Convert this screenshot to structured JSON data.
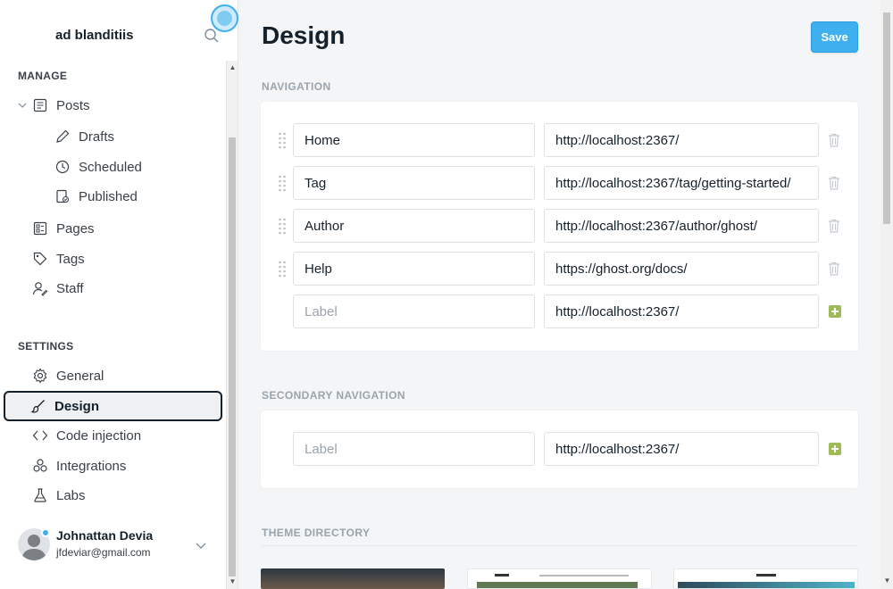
{
  "sidebar": {
    "blog_title": "ad blanditiis",
    "manage_label": "MANAGE",
    "settings_label": "SETTINGS",
    "manage_items": [
      {
        "label": "Posts",
        "icon": "posts-icon"
      },
      {
        "label": "Drafts",
        "icon": "pencil-icon"
      },
      {
        "label": "Scheduled",
        "icon": "clock-icon"
      },
      {
        "label": "Published",
        "icon": "published-icon"
      },
      {
        "label": "Pages",
        "icon": "pages-icon"
      },
      {
        "label": "Tags",
        "icon": "tag-icon"
      },
      {
        "label": "Staff",
        "icon": "staff-icon"
      }
    ],
    "settings_items": [
      {
        "label": "General",
        "icon": "gear-icon"
      },
      {
        "label": "Design",
        "icon": "brush-icon",
        "active": true
      },
      {
        "label": "Code injection",
        "icon": "code-icon"
      },
      {
        "label": "Integrations",
        "icon": "integrations-icon"
      },
      {
        "label": "Labs",
        "icon": "flask-icon"
      }
    ],
    "user": {
      "name": "Johnattan Devia",
      "email": "jfdeviar@gmail.com"
    }
  },
  "header": {
    "title": "Design",
    "save_label": "Save"
  },
  "navigation": {
    "heading": "NAVIGATION",
    "items": [
      {
        "label": "Home",
        "url": "http://localhost:2367/"
      },
      {
        "label": "Tag",
        "url": "http://localhost:2367/tag/getting-started/"
      },
      {
        "label": "Author",
        "url": "http://localhost:2367/author/ghost/"
      },
      {
        "label": "Help",
        "url": "https://ghost.org/docs/"
      }
    ],
    "new_item": {
      "placeholder": "Label",
      "url": "http://localhost:2367/"
    }
  },
  "secondary_navigation": {
    "heading": "SECONDARY NAVIGATION",
    "new_item": {
      "placeholder": "Label",
      "url": "http://localhost:2367/"
    }
  },
  "theme_directory": {
    "heading": "THEME DIRECTORY"
  },
  "colors": {
    "accent": "#3eb0ef",
    "add": "#9fbb58",
    "active_border": "#15212a"
  }
}
